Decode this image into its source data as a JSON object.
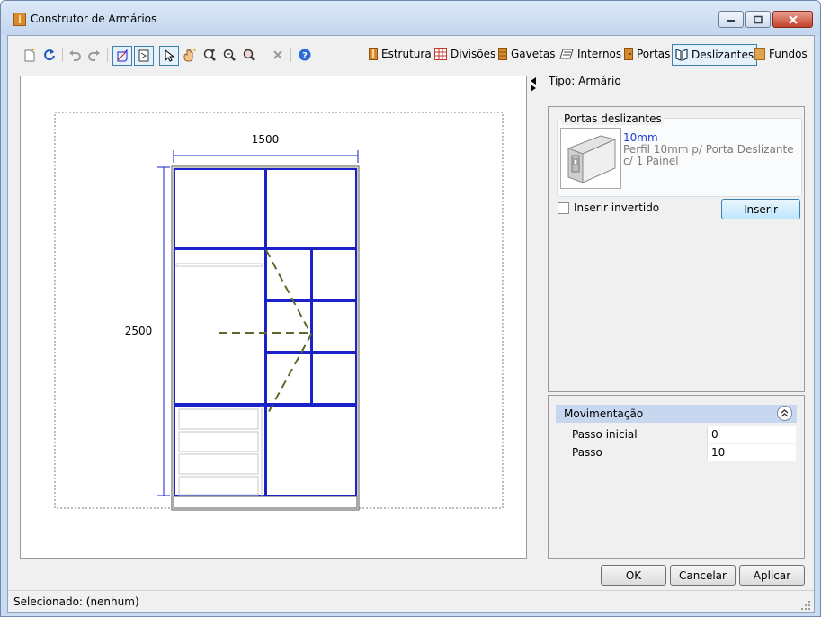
{
  "window": {
    "title": "Construtor de Armários"
  },
  "toolbar": {
    "tabs": [
      {
        "label": "Estrutura",
        "icon": "cabinet-structure-icon"
      },
      {
        "label": "Divisões",
        "icon": "grid-divisions-icon"
      },
      {
        "label": "Gavetas",
        "icon": "drawers-icon"
      },
      {
        "label": "Internos",
        "icon": "internals-icon"
      },
      {
        "label": "Portas",
        "icon": "door-icon"
      },
      {
        "label": "Deslizantes",
        "icon": "sliding-doors-icon"
      },
      {
        "label": "Fundos",
        "icon": "back-panel-icon"
      }
    ],
    "active_tab": "Deslizantes"
  },
  "canvas": {
    "width_label": "1500",
    "height_label": "2500"
  },
  "side": {
    "tipo": "Tipo: Armário",
    "group_title": "Portas deslizantes",
    "profile_name": "10mm",
    "profile_desc": "Perfil 10mm p/ Porta Deslizante c/ 1 Painel",
    "checkbox_label": "Inserir invertido",
    "checkbox_checked": false,
    "insert_label": "Inserir"
  },
  "movimentacao": {
    "title": "Movimentação",
    "rows": [
      {
        "key": "Passo inicial",
        "value": "0"
      },
      {
        "key": "Passo",
        "value": "10"
      }
    ]
  },
  "buttons": {
    "ok": "OK",
    "cancel": "Cancelar",
    "apply": "Aplicar"
  },
  "status": {
    "text": "Selecionado: (nenhum)"
  },
  "colors": {
    "accent": "#3c7fb1",
    "cabinet_blue": "#1a22c8",
    "door_dash": "#5a6a2a"
  }
}
